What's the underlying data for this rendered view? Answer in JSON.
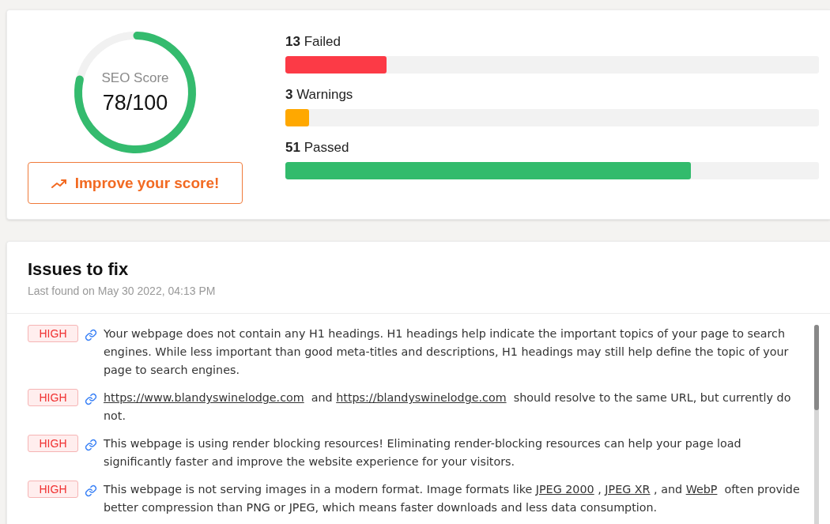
{
  "score": {
    "label": "SEO Score",
    "value": "78/100"
  },
  "improve_button": {
    "label": "Improve your score!"
  },
  "stats": [
    {
      "label": "**13** Failed",
      "level": 0.19,
      "color": "#fc3a46"
    },
    {
      "label": "**3** Warnings",
      "level": 0.045,
      "color": "#ffa800"
    },
    {
      "label": "**51** Passed",
      "level": 0.76,
      "color": "#32bb6c"
    }
  ],
  "issues_panel": {
    "title": "Issues to fix",
    "subtitle": "Last found on May 30 2022, 04:13 PM",
    "issues": [
      {
        "severity": "HIGH",
        "parts": [
          {
            "kind": "text",
            "text": "Your webpage does not contain any H1 headings. H1 headings help indicate the important topics of your page to search engines. While less important than good meta-titles and descriptions, H1 headings may still help define the topic of your page to search engines."
          }
        ]
      },
      {
        "severity": "HIGH",
        "parts": [
          {
            "kind": "link",
            "text": "https://www.blandyswinelodge.com"
          },
          {
            "kind": "text",
            "text": "  and "
          },
          {
            "kind": "link",
            "text": "https://blandyswinelodge.com"
          },
          {
            "kind": "text",
            "text": "  should resolve to the same URL, but currently do not."
          }
        ]
      },
      {
        "severity": "HIGH",
        "parts": [
          {
            "kind": "text",
            "text": "This webpage is using render blocking resources! Eliminating render-blocking resources can help your page load significantly faster and improve the website experience for your visitors."
          }
        ]
      },
      {
        "severity": "HIGH",
        "parts": [
          {
            "kind": "text",
            "text": "This webpage is not serving images in a modern format. Image formats like "
          },
          {
            "kind": "link",
            "text": "JPEG 2000"
          },
          {
            "kind": "text",
            "text": " , "
          },
          {
            "kind": "link",
            "text": "JPEG XR"
          },
          {
            "kind": "text",
            "text": " , and "
          },
          {
            "kind": "link",
            "text": "WebP"
          },
          {
            "kind": "text",
            "text": "  often provide better compression than PNG or JPEG, which means faster downloads and less data consumption."
          }
        ]
      }
    ]
  }
}
